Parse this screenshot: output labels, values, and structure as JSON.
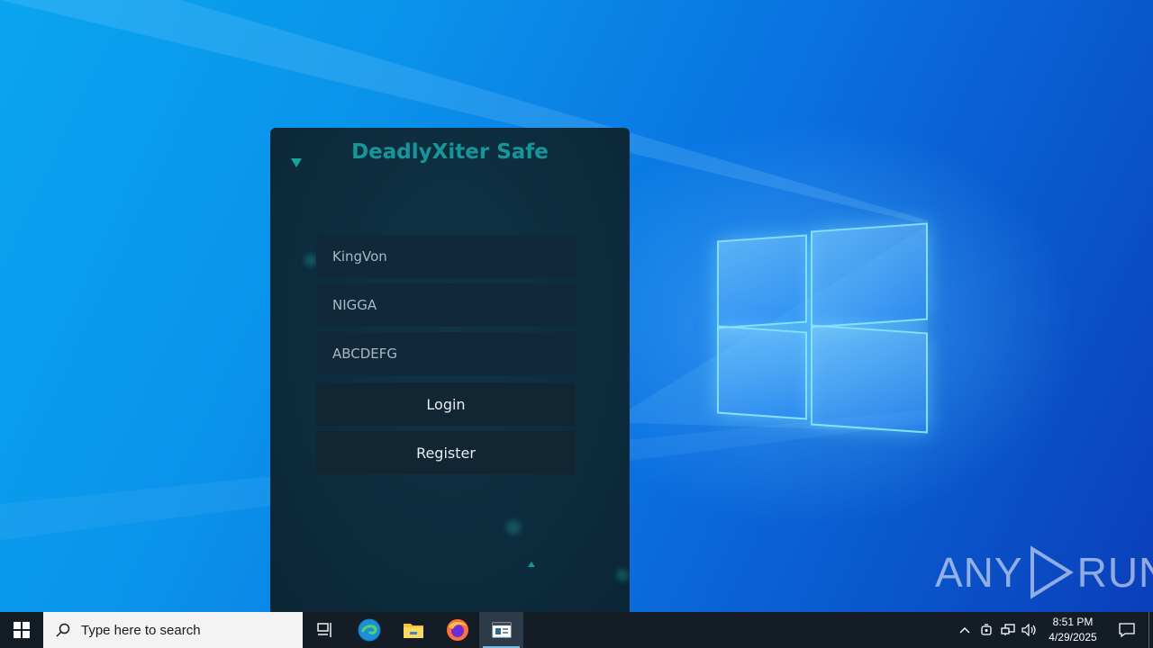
{
  "app": {
    "title": "DeadlyXiter Safe",
    "username_value": "KingVon",
    "password_value": "NIGGA",
    "key_value": "ABCDEFG",
    "login_label": "Login",
    "register_label": "Register"
  },
  "taskbar": {
    "search_placeholder": "Type here to search",
    "time": "8:51 PM",
    "date": "4/29/2025"
  },
  "watermark": {
    "left": "ANY",
    "right": "RUN"
  },
  "colors": {
    "accent": "#16969b",
    "panel": "#0d2c3e",
    "field": "#10283a",
    "button": "#122533",
    "taskbar": "#141c26"
  }
}
